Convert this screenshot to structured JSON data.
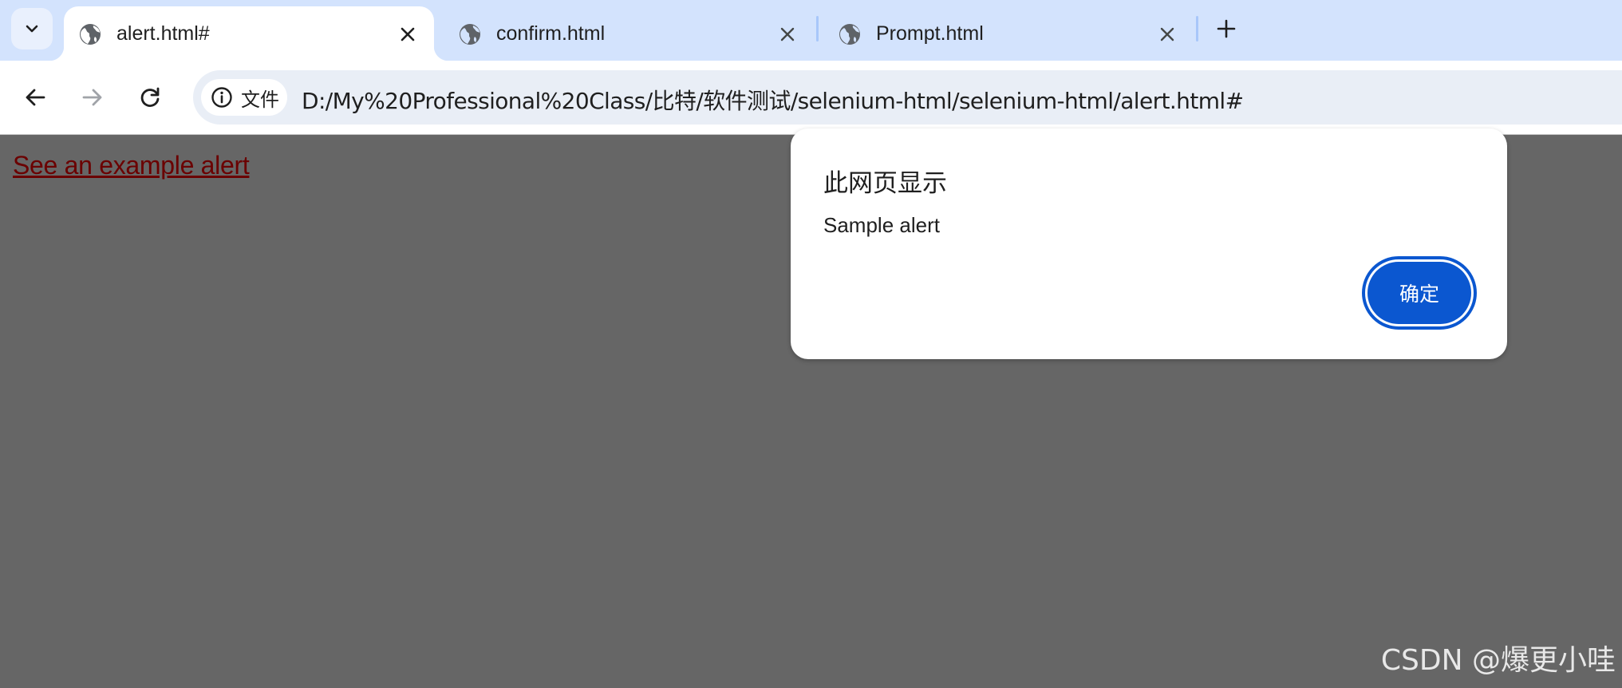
{
  "browser": {
    "tabs": [
      {
        "title": "alert.html#",
        "active": true,
        "favicon": "globe-icon"
      },
      {
        "title": "confirm.html",
        "active": false,
        "favicon": "globe-icon"
      },
      {
        "title": "Prompt.html",
        "active": false,
        "favicon": "globe-icon"
      }
    ],
    "new_tab_icon": "plus-icon",
    "tab_search_icon": "chevron-down-icon",
    "nav": {
      "back_icon": "arrow-left-icon",
      "forward_icon": "arrow-right-icon",
      "reload_icon": "reload-icon"
    },
    "omnibox": {
      "security_label": "文件",
      "security_icon": "info-icon",
      "url": "D:/My%20Professional%20Class/比特/软件测试/selenium-html/selenium-html/alert.html#"
    }
  },
  "page": {
    "link_text": "See an example alert",
    "link_color": "#6b0000",
    "background_color": "#666666"
  },
  "dialog": {
    "title": "此网页显示",
    "message": "Sample alert",
    "ok_label": "确定",
    "accent_color": "#0b57d0"
  },
  "watermark": "CSDN @爆更小哇"
}
